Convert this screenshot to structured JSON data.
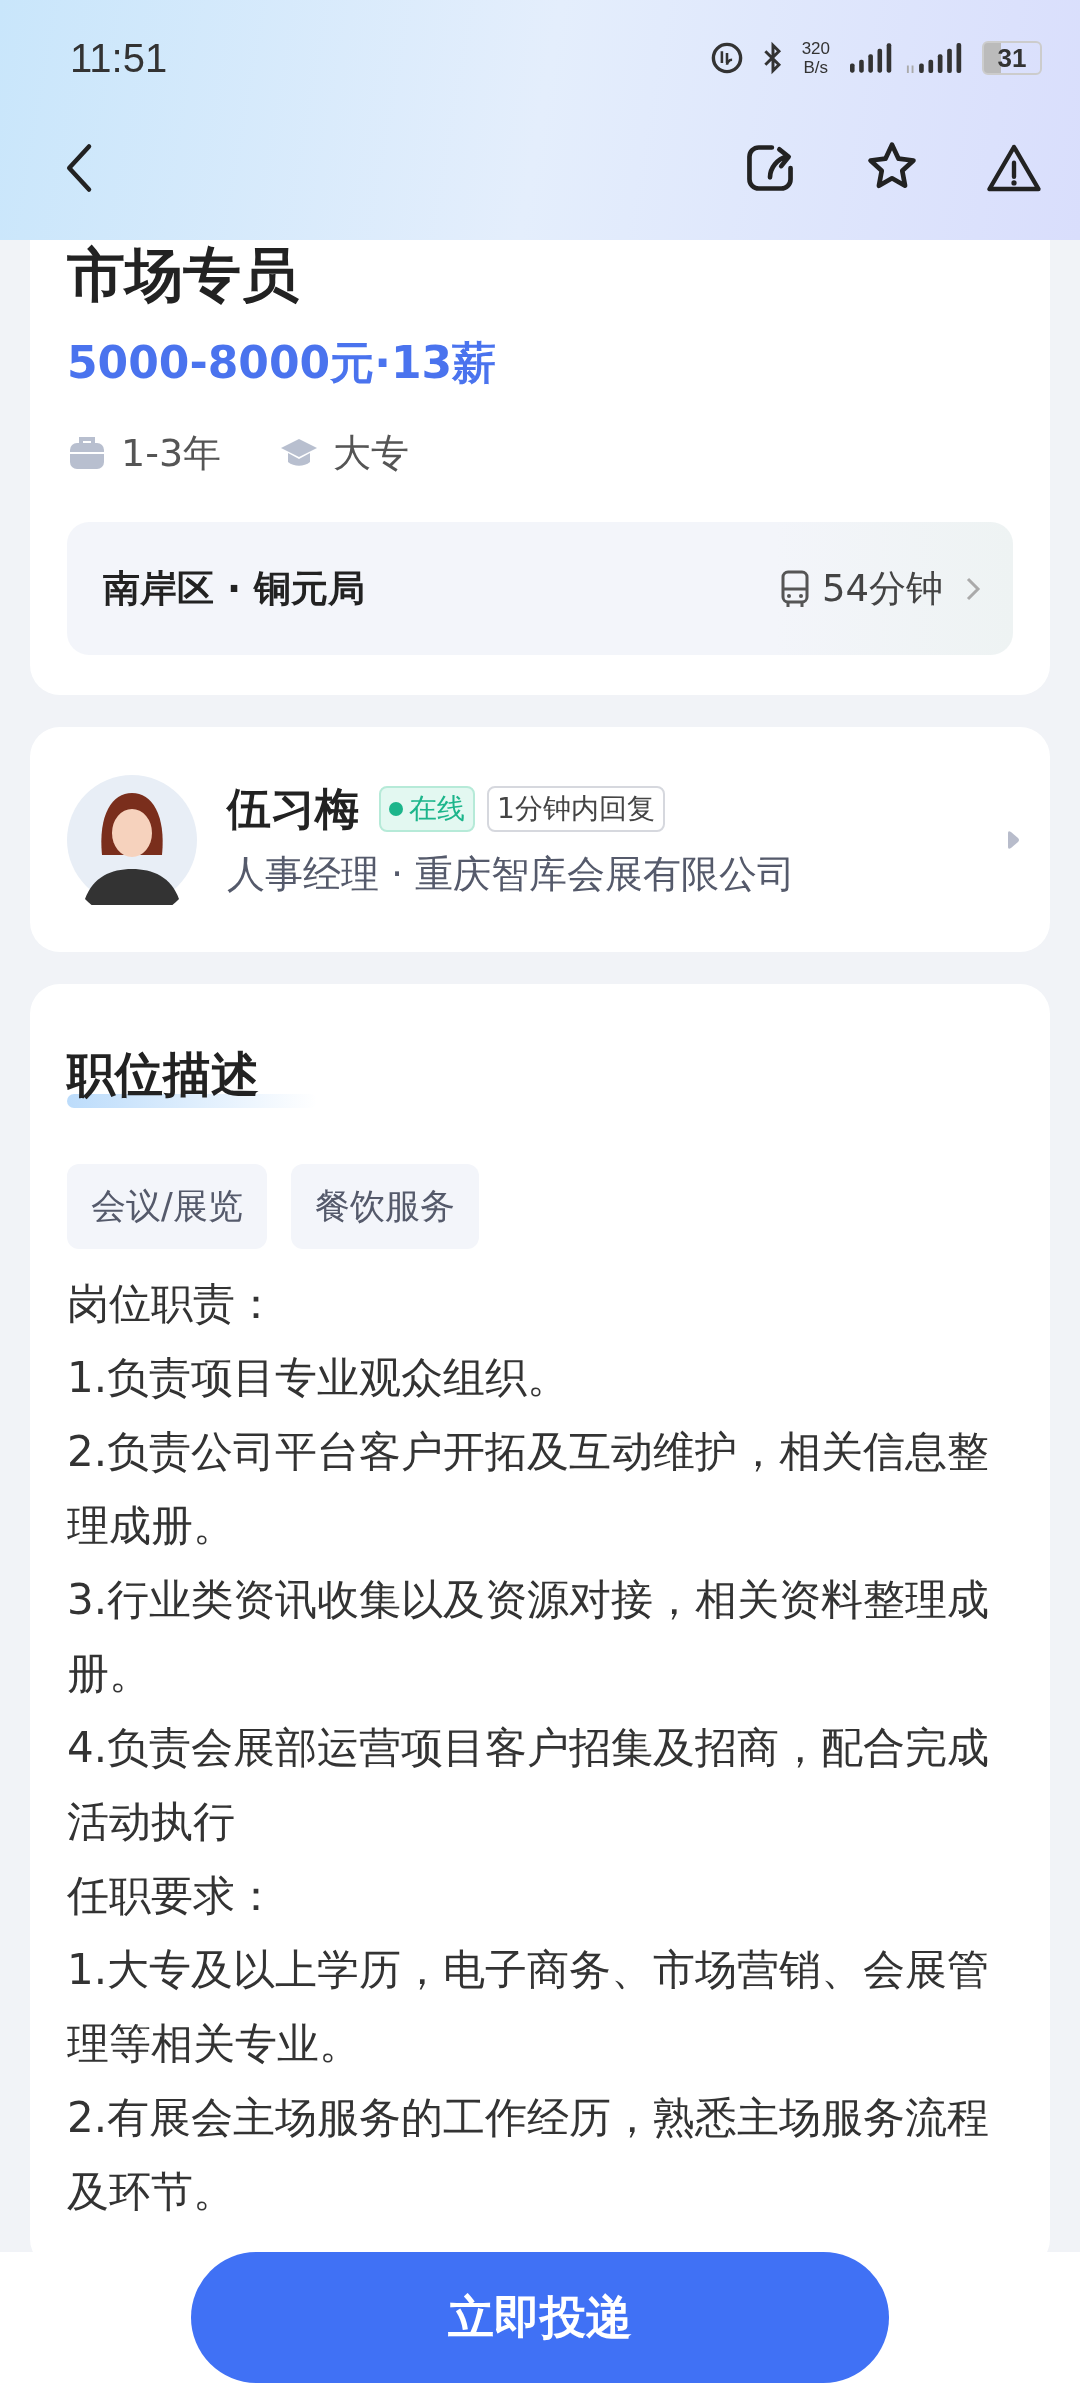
{
  "status_bar": {
    "time": "11:51",
    "net_speed": [
      "320",
      "B/s"
    ],
    "battery": "31"
  },
  "job": {
    "title": "市场专员",
    "salary": "5000-8000元·13薪",
    "requirements": [
      {
        "kind": "experience",
        "text": "1-3年"
      },
      {
        "kind": "education",
        "text": "大专"
      }
    ],
    "location": "南岸区 · 铜元局",
    "commute": "54分钟"
  },
  "recruiter": {
    "name": "伍习梅",
    "online": true,
    "online_label": "在线",
    "reply_badge": "1分钟内回复",
    "position": "人事经理 · 重庆智库会展有限公司"
  },
  "description": {
    "title": "职位描述",
    "tags": [
      "会议/展览",
      "餐饮服务"
    ],
    "lines": [
      "岗位职责：",
      "1.负责项目专业观众组织。",
      "2.负责公司平台客户开拓及互动维护，相关信息整理成册。",
      "3.行业类资讯收集以及资源对接，相关资料整理成册。",
      "4.负责会展部运营项目客户招集及招商，配合完成活动执行",
      "任职要求：",
      "1.大专及以上学历，电子商务、市场营销、会展管理等相关专业。",
      "2.有展会主场服务的工作经历，熟悉主场服务流程及环节。"
    ]
  },
  "apply_button": "立即投递"
}
